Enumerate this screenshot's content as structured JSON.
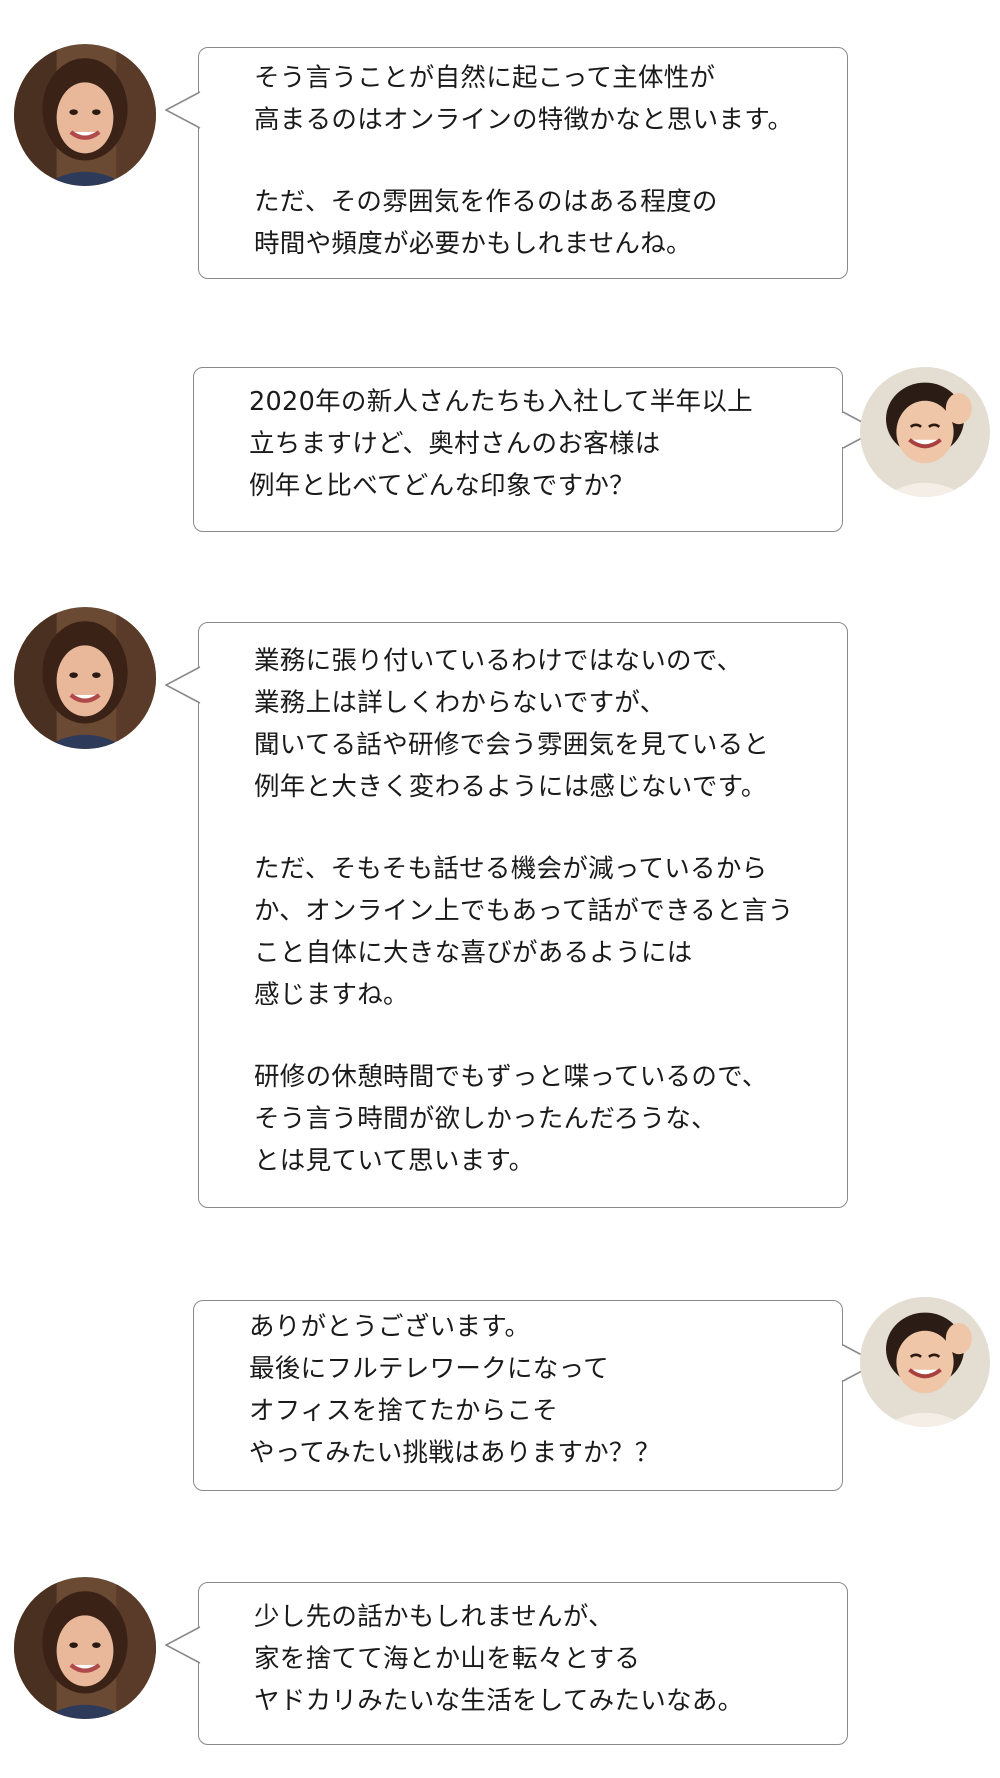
{
  "messages": [
    {
      "speaker": "left",
      "lines": [
        "そう言うことが自然に起こって主体性が",
        "高まるのはオンラインの特徴かなと思います。",
        "",
        "ただ、その雰囲気を作るのはある程度の",
        "時間や頻度が必要かもしれませんね。"
      ]
    },
    {
      "speaker": "right",
      "lines": [
        "2020年の新人さんたちも入社して半年以上",
        "立ちますけど、奥村さんのお客様は",
        "例年と比べてどんな印象ですか？"
      ]
    },
    {
      "speaker": "left",
      "lines": [
        "業務に張り付いているわけではないので、",
        "業務上は詳しくわからないですが、",
        "聞いてる話や研修で会う雰囲気を見ていると",
        "例年と大きく変わるようには感じないです。",
        "",
        "ただ、そもそも話せる機会が減っているから",
        "か、オンライン上でもあって話ができると言う",
        "こと自体に大きな喜びがあるようには",
        "感じますね。",
        "",
        "研修の休憩時間でもずっと喋っているので、",
        "そう言う時間が欲しかったんだろうな、",
        "とは見ていて思います。"
      ]
    },
    {
      "speaker": "right",
      "lines": [
        "ありがとうございます。",
        "最後にフルテレワークになって",
        "オフィスを捨てたからこそ",
        "やってみたい挑戦はありますか？？"
      ]
    },
    {
      "speaker": "left",
      "lines": [
        "少し先の話かもしれませんが、",
        "家を捨てて海とか山を転々とする",
        "ヤドカリみたいな生活をしてみたいなあ。"
      ]
    }
  ],
  "colors": {
    "bubble_border": "#8a8a8a",
    "text": "#1a1a1a",
    "background": "#ffffff"
  }
}
